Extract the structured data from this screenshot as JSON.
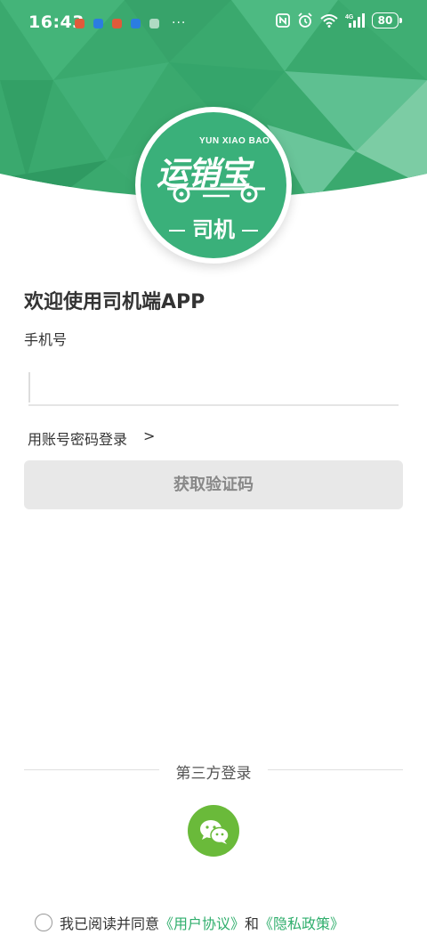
{
  "status_bar": {
    "time": "16:43",
    "battery": "80",
    "network": "4G",
    "more": "···"
  },
  "logo": {
    "brand_en": "YUN XIAO BAO",
    "brand": "运销宝",
    "role": "司机"
  },
  "form": {
    "welcome": "欢迎使用司机端APP",
    "phone_label": "手机号",
    "phone_value": "",
    "password_login": "用账号密码登录",
    "password_login_arrow": ">",
    "get_code_button": "获取验证码"
  },
  "third_party": {
    "label": "第三方登录",
    "wechat_icon": "wechat-icon"
  },
  "agreement": {
    "prefix": "我已阅读并同意",
    "user_agreement": "《用户协议》",
    "and": "和",
    "privacy_policy": "《隐私政策》"
  },
  "colors": {
    "brand_green": "#3ab07a",
    "link_green": "#2fae6c",
    "wechat_green": "#6aba3a",
    "button_disabled_bg": "#e8e8e8"
  }
}
